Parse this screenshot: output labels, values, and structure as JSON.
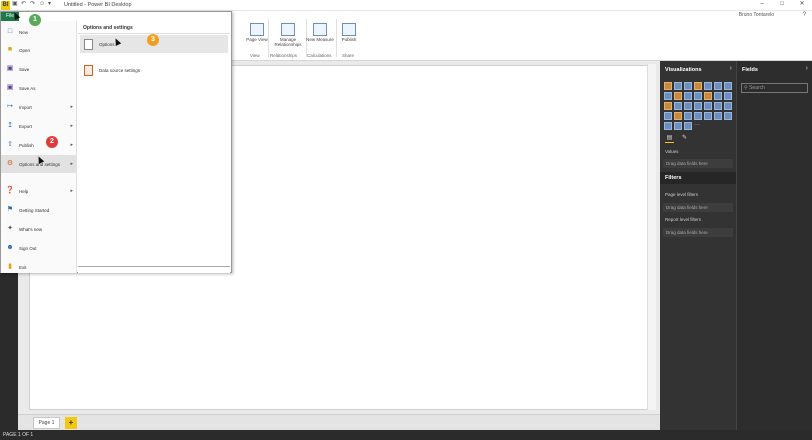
{
  "title_bar": {
    "app_logo": "BI",
    "window_title": "Untitled - Power BI Desktop",
    "user_name": "Bruno Tontarelo",
    "window_controls": [
      "–",
      "□",
      "✕"
    ]
  },
  "ribbon": {
    "file_tab": "File",
    "buttons": [
      {
        "label": "Page View",
        "icon": "page-view-icon"
      },
      {
        "label": "Manage Relationships",
        "icon": "relationships-icon"
      },
      {
        "label": "New Measure",
        "icon": "measure-icon"
      },
      {
        "label": "Publish",
        "icon": "publish-icon"
      }
    ],
    "groups": [
      "View",
      "Relationships",
      "Calculations",
      "Share"
    ]
  },
  "file_menu": {
    "tab_label": "File",
    "items": [
      {
        "label": "New",
        "icon": "new-icon",
        "has_arrow": false
      },
      {
        "label": "Open",
        "icon": "open-icon",
        "has_arrow": false
      },
      {
        "label": "Save",
        "icon": "save-icon",
        "has_arrow": false
      },
      {
        "label": "Save As",
        "icon": "save-as-icon",
        "has_arrow": false
      },
      {
        "label": "Import",
        "icon": "import-icon",
        "has_arrow": true
      },
      {
        "label": "Export",
        "icon": "export-icon",
        "has_arrow": true
      },
      {
        "label": "Publish",
        "icon": "publish-icon",
        "has_arrow": true
      },
      {
        "label": "Options and settings",
        "icon": "options-icon",
        "has_arrow": true
      },
      {
        "label": "Help",
        "icon": "help-icon",
        "has_arrow": true
      },
      {
        "label": "Getting Started",
        "icon": "getting-started-icon",
        "has_arrow": false
      },
      {
        "label": "What's new",
        "icon": "whats-new-icon",
        "has_arrow": false
      },
      {
        "label": "Sign Out",
        "icon": "sign-out-icon",
        "has_arrow": false
      },
      {
        "label": "Exit",
        "icon": "exit-icon",
        "has_arrow": false
      }
    ],
    "submenu": {
      "title": "Options and settings",
      "items": [
        {
          "label": "Options",
          "icon": "options-page-icon"
        },
        {
          "label": "Data source settings",
          "icon": "data-source-settings-icon"
        }
      ]
    }
  },
  "step_badges": [
    {
      "number": "1",
      "color": "#5aa85a"
    },
    {
      "number": "2",
      "color": "#e03a3a"
    },
    {
      "number": "3",
      "color": "#f0a020"
    }
  ],
  "visualizations": {
    "title": "Visualizations",
    "fields_tab_icon": "fields-well-icon",
    "format_tab_icon": "format-paint-icon",
    "values_label": "Values",
    "values_drop": "Drag data fields here"
  },
  "filters": {
    "title": "Filters",
    "page_level": "Page level filters",
    "page_drop": "Drag data fields here",
    "report_level": "Report level filters",
    "report_drop": "Drag data fields here"
  },
  "fields": {
    "title": "Fields",
    "search_placeholder": "Search"
  },
  "page_tabs": {
    "tabs": [
      "Page 1"
    ],
    "add_label": "+"
  },
  "status_bar": {
    "text": "PAGE 1 OF 1"
  },
  "colors": {
    "accent_yellow": "#f2c811",
    "pane_dark": "#333333",
    "file_tab_green": "#1f7a4a"
  }
}
